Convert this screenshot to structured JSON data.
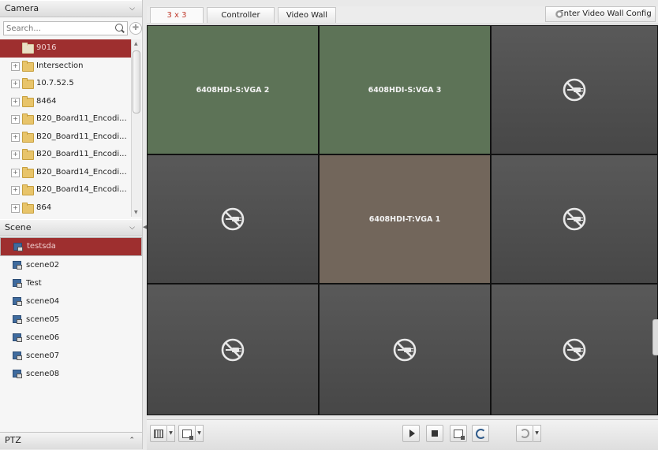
{
  "camera_panel": {
    "title": "Camera",
    "search_placeholder": "Search...",
    "items": [
      {
        "label": "9016",
        "selected": true,
        "expandable": false
      },
      {
        "label": "Intersection",
        "selected": false,
        "expandable": true
      },
      {
        "label": "10.7.52.5",
        "selected": false,
        "expandable": true
      },
      {
        "label": "8464",
        "selected": false,
        "expandable": true
      },
      {
        "label": "B20_Board11_Encodi...",
        "selected": false,
        "expandable": true
      },
      {
        "label": "B20_Board11_Encodi...",
        "selected": false,
        "expandable": true
      },
      {
        "label": "B20_Board11_Encodi...",
        "selected": false,
        "expandable": true
      },
      {
        "label": "B20_Board14_Encodi...",
        "selected": false,
        "expandable": true
      },
      {
        "label": "B20_Board14_Encodi...",
        "selected": false,
        "expandable": true
      },
      {
        "label": "864",
        "selected": false,
        "expandable": true
      }
    ]
  },
  "scene_panel": {
    "title": "Scene",
    "items": [
      {
        "label": "testsda",
        "selected": true
      },
      {
        "label": "scene02",
        "selected": false
      },
      {
        "label": "Test",
        "selected": false
      },
      {
        "label": "scene04",
        "selected": false
      },
      {
        "label": "scene05",
        "selected": false
      },
      {
        "label": "scene06",
        "selected": false
      },
      {
        "label": "scene07",
        "selected": false
      },
      {
        "label": "scene08",
        "selected": false
      }
    ]
  },
  "ptz_panel": {
    "title": "PTZ"
  },
  "tabs": [
    {
      "label": "3 x 3",
      "active": true
    },
    {
      "label": "Controller",
      "active": false
    },
    {
      "label": "Video Wall",
      "active": false
    }
  ],
  "enter_config_label": "Enter Video Wall Config",
  "wall_cells": [
    {
      "label": "6408HDI-S:VGA 2",
      "state": "green"
    },
    {
      "label": "6408HDI-S:VGA 3",
      "state": "green"
    },
    {
      "label": "",
      "state": "empty"
    },
    {
      "label": "",
      "state": "empty"
    },
    {
      "label": "6408HDI-T:VGA 1",
      "state": "brown"
    },
    {
      "label": "",
      "state": "empty"
    },
    {
      "label": "",
      "state": "empty"
    },
    {
      "label": "",
      "state": "empty"
    },
    {
      "label": "",
      "state": "empty"
    }
  ],
  "icons": {
    "empty_cell": "no-signal-icon",
    "camera_node": "folder-icon",
    "scene_node": "scene-icon",
    "config": "gear-icon"
  },
  "colors": {
    "selection": "#9e2f2f",
    "active_tab_text": "#c0392b",
    "cell_green": "#5d7357",
    "cell_brown": "#72665b",
    "cell_empty": "#505050"
  }
}
